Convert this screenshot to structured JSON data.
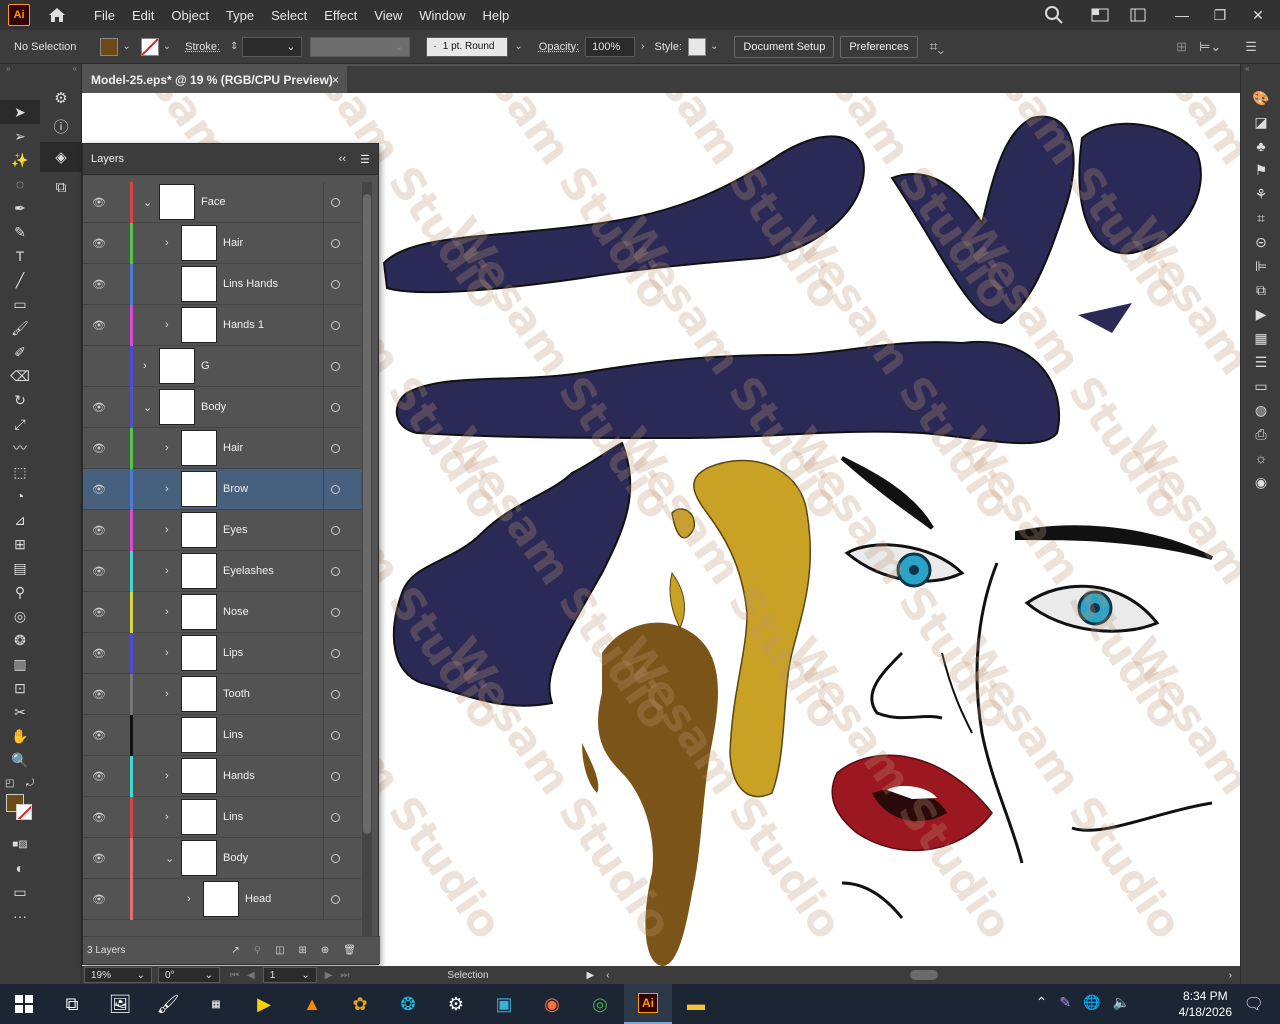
{
  "app": {
    "logo": "Ai",
    "doc_tab": "Model-25.eps* @ 19 % (RGB/CPU Preview)",
    "close": "×"
  },
  "menu": [
    "File",
    "Edit",
    "Object",
    "Type",
    "Select",
    "Effect",
    "View",
    "Window",
    "Help"
  ],
  "control": {
    "selection": "No Selection",
    "stroke_label": "Stroke:",
    "brush": "1 pt. Round",
    "opacity_label": "Opacity:",
    "opacity": "100%",
    "style_label": "Style:",
    "document_setup": "Document Setup",
    "preferences": "Preferences",
    "fill_color": "#6b4a16"
  },
  "layers_panel": {
    "title": "Layers",
    "count": "3 Layers",
    "rows": [
      {
        "name": "Face",
        "color": "#d64545",
        "indent": 0,
        "chevron": "⌄",
        "visible": true
      },
      {
        "name": "Hair",
        "color": "#52c447",
        "indent": 1,
        "chevron": "›",
        "visible": true
      },
      {
        "name": "Lins Hands",
        "color": "#4d7bd6",
        "indent": 1,
        "chevron": "",
        "visible": true
      },
      {
        "name": "Hands 1",
        "color": "#d64ad6",
        "indent": 1,
        "chevron": "›",
        "visible": true
      },
      {
        "name": "G",
        "color": "#4a4ad6",
        "indent": 0,
        "chevron": "›",
        "visible": false
      },
      {
        "name": "Body",
        "color": "#5252c4",
        "indent": 0,
        "chevron": "⌄",
        "visible": true
      },
      {
        "name": "Hair",
        "color": "#52c447",
        "indent": 1,
        "chevron": "›",
        "visible": true
      },
      {
        "name": "Brow",
        "color": "#4d7bd6",
        "indent": 1,
        "chevron": "›",
        "visible": true
      },
      {
        "name": "Eyes",
        "color": "#d64ad6",
        "indent": 1,
        "chevron": "›",
        "visible": true
      },
      {
        "name": "Eyelashes",
        "color": "#43d6d6",
        "indent": 1,
        "chevron": "›",
        "visible": true
      },
      {
        "name": "Nose",
        "color": "#d6d643",
        "indent": 1,
        "chevron": "›",
        "visible": true
      },
      {
        "name": "Lips",
        "color": "#4a4ad6",
        "indent": 1,
        "chevron": "›",
        "visible": true
      },
      {
        "name": "Tooth",
        "color": "#777777",
        "indent": 1,
        "chevron": "›",
        "visible": true
      },
      {
        "name": "Lins",
        "color": "#111111",
        "indent": 1,
        "chevron": "",
        "visible": true
      },
      {
        "name": "Hands",
        "color": "#43d6d6",
        "indent": 1,
        "chevron": "›",
        "visible": true
      },
      {
        "name": "Lins",
        "color": "#d64545",
        "indent": 1,
        "chevron": "›",
        "visible": true
      },
      {
        "name": "Body",
        "color": "#e07070",
        "indent": 1,
        "chevron": "⌄",
        "visible": true
      },
      {
        "name": "Head",
        "color": "#e07070",
        "indent": 2,
        "chevron": "›",
        "visible": true
      }
    ]
  },
  "status": {
    "zoom": "19%",
    "rotation": "0°",
    "artboard": "1",
    "tool": "Selection"
  },
  "taskbar": {
    "time": "8:34 PM",
    "date": "4/18/2026"
  },
  "watermark": "Wesam Studio"
}
